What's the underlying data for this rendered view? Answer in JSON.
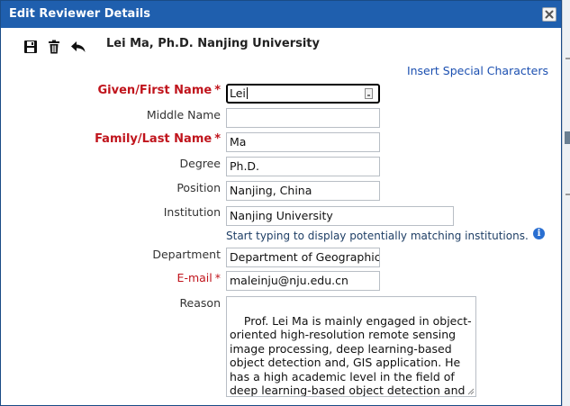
{
  "dialog": {
    "title": "Edit Reviewer Details",
    "close_icon": "close-x"
  },
  "toolbar": {
    "save_icon": "floppy-disk",
    "delete_icon": "trash-can",
    "back_icon": "undo-arrow"
  },
  "header": {
    "person": "Lei Ma, Ph.D. Nanjing University"
  },
  "special_characters_link": "Insert Special Characters",
  "form": {
    "first_name": {
      "label": "Given/First Name",
      "required": "*",
      "value": "Lei"
    },
    "middle_name": {
      "label": "Middle Name",
      "value": ""
    },
    "last_name": {
      "label": "Family/Last Name",
      "required": "*",
      "value": "Ma"
    },
    "degree": {
      "label": "Degree",
      "value": "Ph.D."
    },
    "position": {
      "label": "Position",
      "value": "Nanjing, China"
    },
    "institution": {
      "label": "Institution",
      "value": "Nanjing University",
      "helper": "Start typing to display potentially matching institutions."
    },
    "department": {
      "label": "Department",
      "value": "Department of Geographic"
    },
    "email": {
      "label": "E-mail",
      "required": "*",
      "value": "maleinju@nju.edu.cn"
    },
    "reason": {
      "label": "Reason",
      "value": "Prof. Lei Ma is mainly engaged in object-\noriented high-resolution remote sensing\nimage processing, deep learning-based\nobject detection and, GIS application. He\nhas a high academic level in the field of\ndeep learning-based object detection and\nremote sensing application."
    }
  },
  "colors": {
    "titlebar": "#1f5fae",
    "required_label": "#c0141c",
    "link": "#1b4fb0"
  }
}
